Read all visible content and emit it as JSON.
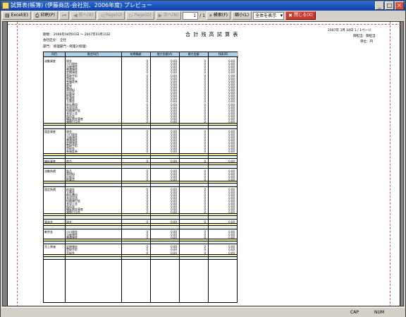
{
  "window": {
    "title": "試算表(帳簿) (伊藤商店-会社別、2006年度)  プレビュー",
    "buttons": [
      "_",
      "□",
      "×"
    ]
  },
  "toolbar": {
    "items": [
      {
        "icon": "export-icon",
        "label": "Excel(E)",
        "enabled": true
      },
      {
        "icon": "printer-icon",
        "label": "印刷(P)",
        "enabled": true
      },
      {
        "icon": "first-page-icon",
        "label": "",
        "enabled": false
      },
      {
        "icon": "prev-icon",
        "label": "前へ(B)",
        "enabled": false
      },
      {
        "icon": "prev-page-icon",
        "label": "Page(U)",
        "enabled": false
      },
      {
        "icon": "next-page-icon",
        "label": "Page(D)",
        "enabled": false
      },
      {
        "icon": "last-page-icon",
        "label": "次へ(N)",
        "enabled": false
      }
    ],
    "page_current": "1",
    "page_total": "/ 1",
    "find": "検索(F)",
    "zoom_out": "縮小(L)",
    "zoom_select": "全体を表示",
    "close": "閉じる(X)"
  },
  "report": {
    "period": "期間： 2006年04月01日 ～ 2007年03月31日",
    "company": "会社区分： 全社",
    "dept": "部門： 経理部門・経理2(経理)",
    "title": "合 計 残 高 試 算 表",
    "date": "2007年  3月 18日  1 / 1ページ",
    "user": "御担当：御担当",
    "unit": "単位：円",
    "columns": [
      "科目",
      "勘定科目",
      "前期繰越",
      "借方金額(A)",
      "貸方金額",
      "残高(B)"
    ],
    "groups": [
      {
        "name": "流動資産",
        "rows": 22
      },
      {
        "name": "固定資産",
        "rows": 8
      },
      {
        "name": "繰延資産",
        "rows": 1
      },
      {
        "name": "流動負債",
        "rows": 4
      },
      {
        "name": "固定負債",
        "rows": 9
      },
      {
        "name": "資本金",
        "rows": 1
      },
      {
        "name": "剰余金",
        "rows": 3
      },
      {
        "name": "売上原価",
        "rows": 3
      }
    ],
    "labels": [
      "現金",
      "小口現金",
      "当座預金",
      "普通預金",
      "定期預金",
      "受取手形",
      "売掛金",
      "有価証券",
      "商品",
      "製品",
      "原材料",
      "仕掛品",
      "貯蔵品",
      "前渡金",
      "立替金",
      "前払費用",
      "未収収益",
      "短期貸付金",
      "未収入金",
      "仮払金",
      "繰延税金資産",
      "貸倒引当金"
    ],
    "value_zero": "0",
    "value_amount": "0.00"
  },
  "status": {
    "left": "",
    "caps": "CAP",
    "num": "NUM"
  }
}
